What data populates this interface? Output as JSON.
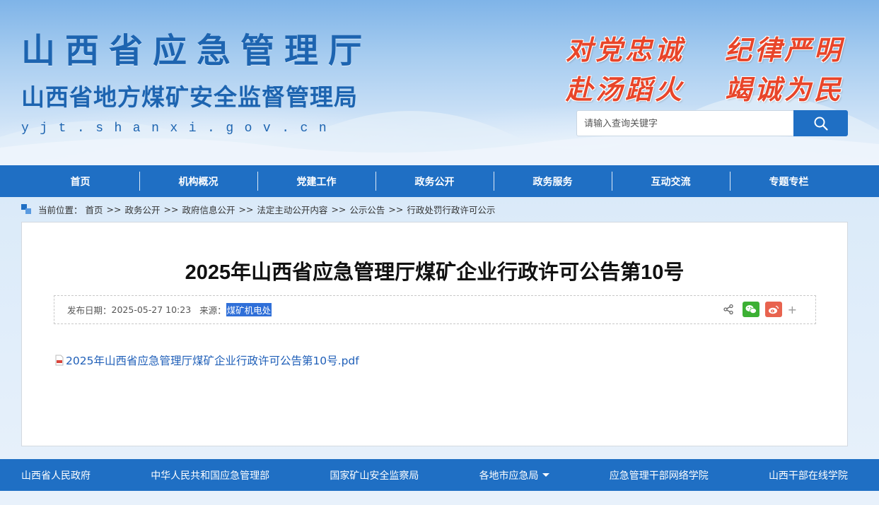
{
  "header": {
    "title": "山西省应急管理厅",
    "subtitle": "山西省地方煤矿安全监督管理局",
    "url": "yjt.shanxi.gov.cn",
    "slogans": [
      "对党忠诚",
      "纪律严明",
      "赴汤蹈火",
      "竭诚为民"
    ],
    "search": {
      "placeholder": "请输入查询关键字",
      "button_icon": "search-icon"
    }
  },
  "nav": {
    "items": [
      "首页",
      "机构概况",
      "党建工作",
      "政务公开",
      "政务服务",
      "互动交流",
      "专题专栏"
    ]
  },
  "breadcrumb": {
    "prefix": "当前位置：",
    "separator": ">>",
    "items": [
      "首页",
      "政务公开",
      "政府信息公开",
      "法定主动公开内容",
      "公示公告",
      "行政处罚行政许可公示"
    ]
  },
  "article": {
    "title": "2025年山西省应急管理厅煤矿企业行政许可公告第10号",
    "date_label": "发布日期：",
    "date": "2025-05-27 10:23",
    "source_label": "来源：",
    "source": "煤矿机电处",
    "share_icons": [
      "share-icon",
      "wechat-icon",
      "weibo-icon",
      "plus-icon"
    ],
    "share_plus": "+",
    "attachment": "2025年山西省应急管理厅煤矿企业行政许可公告第10号.pdf",
    "attachment_icon": "pdf-icon"
  },
  "footer": {
    "links": [
      "山西省人民政府",
      "中华人民共和国应急管理部",
      "国家矿山安全监察局",
      "各地市应急局",
      "应急管理干部网络学院",
      "山西干部在线学院"
    ]
  },
  "colors": {
    "primary": "#1f6fc4",
    "slogan": "#e8452a",
    "link": "#1f5fb8",
    "wechat": "#3cb034",
    "weibo": "#e8634f"
  }
}
